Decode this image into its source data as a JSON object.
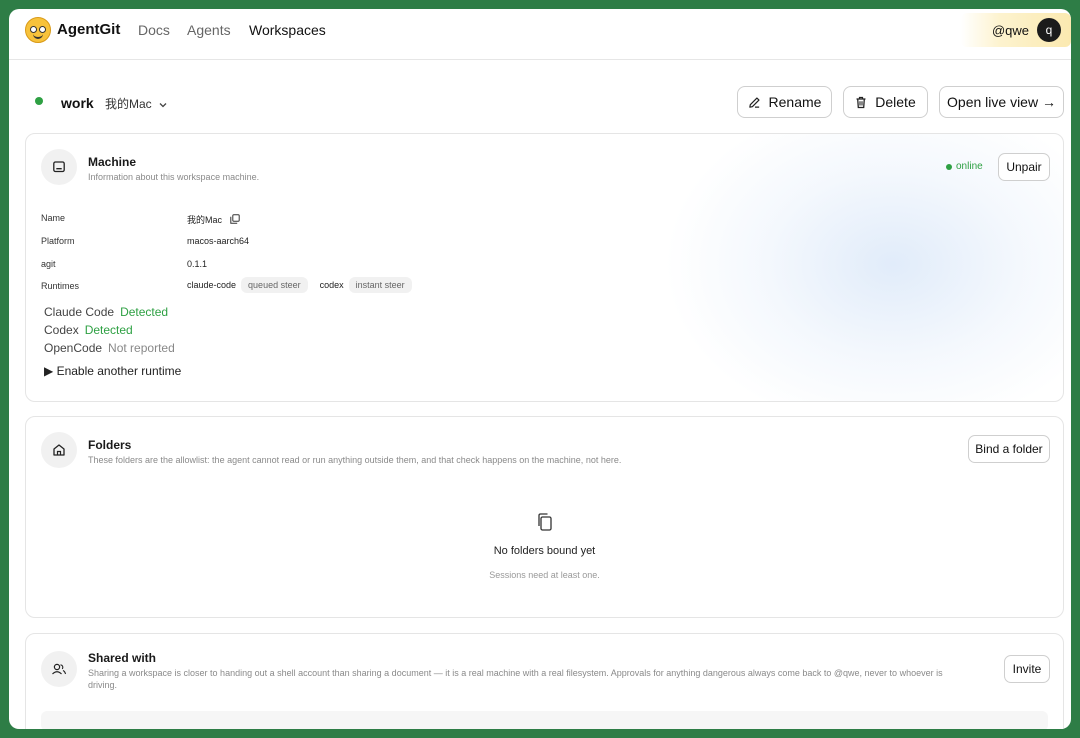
{
  "nav": {
    "brand": "AgentGit",
    "links": [
      "Docs",
      "Agents",
      "Workspaces"
    ],
    "active": "Workspaces",
    "username": "@qwe",
    "avatar_letter": "q"
  },
  "header": {
    "workspace_name": "work",
    "machine_select": "我的Mac",
    "rename_label": "Rename",
    "delete_label": "Delete",
    "live_view_label": "Open live view →"
  },
  "machine": {
    "title": "Machine",
    "subtitle": "Information about this workspace machine.",
    "status": "online",
    "unpair_label": "Unpair",
    "rows": [
      {
        "key": "Name",
        "value": "我的Mac"
      },
      {
        "key": "Platform",
        "value": "macos-aarch64"
      },
      {
        "key": "agit",
        "value": "0.1.1"
      },
      {
        "key": "Runtimes",
        "value": ""
      }
    ],
    "runtime_tags": [
      {
        "name": "claude-code",
        "mode": "queued steer"
      },
      {
        "name": "codex",
        "mode": "instant steer"
      }
    ],
    "runtime_status": [
      {
        "name": "Claude Code",
        "status": "Detected"
      },
      {
        "name": "Codex",
        "status": "Detected"
      },
      {
        "name": "OpenCode",
        "status": "Not reported"
      }
    ],
    "enable_runtime": "▶ Enable another runtime"
  },
  "folders": {
    "title": "Folders",
    "subtitle": "These folders are the allowlist: the agent cannot read or run anything outside them, and that check happens on the machine, not here.",
    "bind_label": "Bind a folder",
    "empty_title": "No folders bound yet",
    "empty_sub": "Sessions need at least one."
  },
  "shared": {
    "title": "Shared with",
    "subtitle": "Sharing a workspace is closer to handing out a shell account than sharing a document — it is a real machine with a real filesystem. Approvals for anything dangerous always come back to @qwe, never to whoever is driving.",
    "invite_label": "Invite"
  },
  "colors": {
    "accent_green": "#2ea043",
    "frame": "#2e7d46"
  }
}
